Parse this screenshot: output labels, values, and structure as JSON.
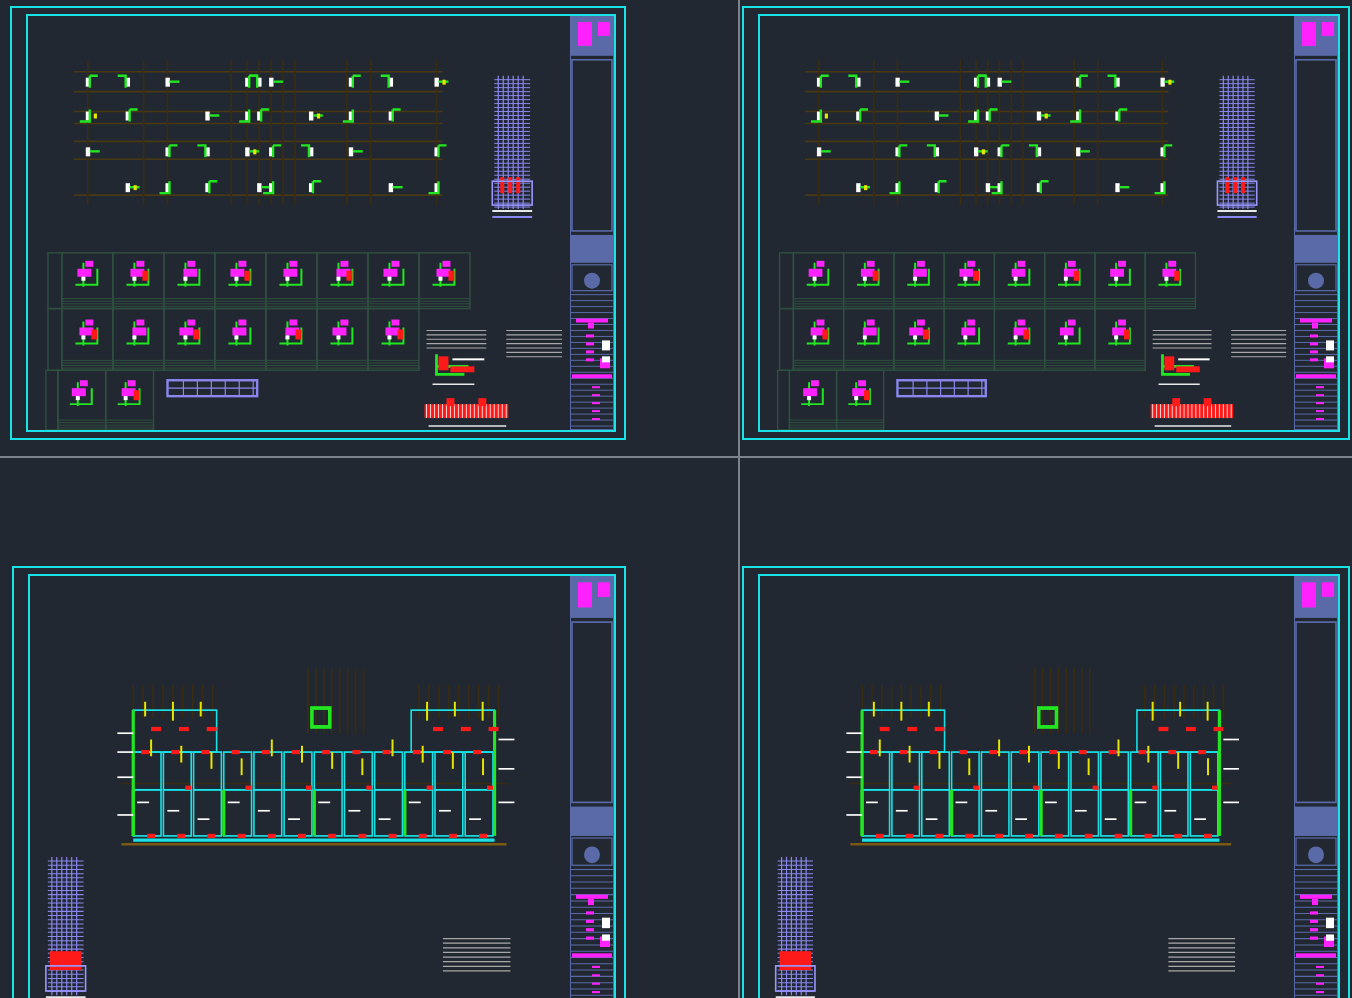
{
  "sheets": [
    {
      "kind": "column-layout"
    },
    {
      "kind": "column-layout"
    },
    {
      "kind": "floor-plan"
    },
    {
      "kind": "floor-plan"
    }
  ]
}
